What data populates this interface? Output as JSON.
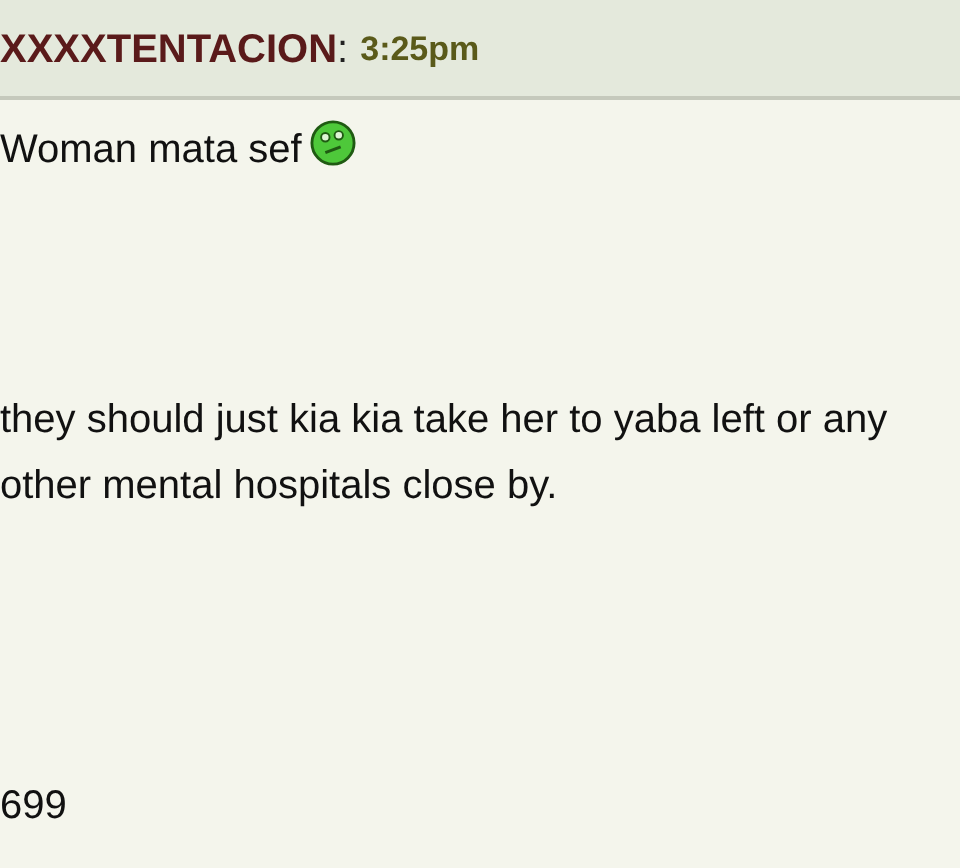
{
  "post": {
    "author": "XXXXTENTACION",
    "separator": ":",
    "time": "3:25pm"
  },
  "body": {
    "first_line": "Woman mata sef",
    "paragraph": "they should just kia kia take her to yaba left or any other mental hospitals close by.",
    "footer": "699"
  }
}
